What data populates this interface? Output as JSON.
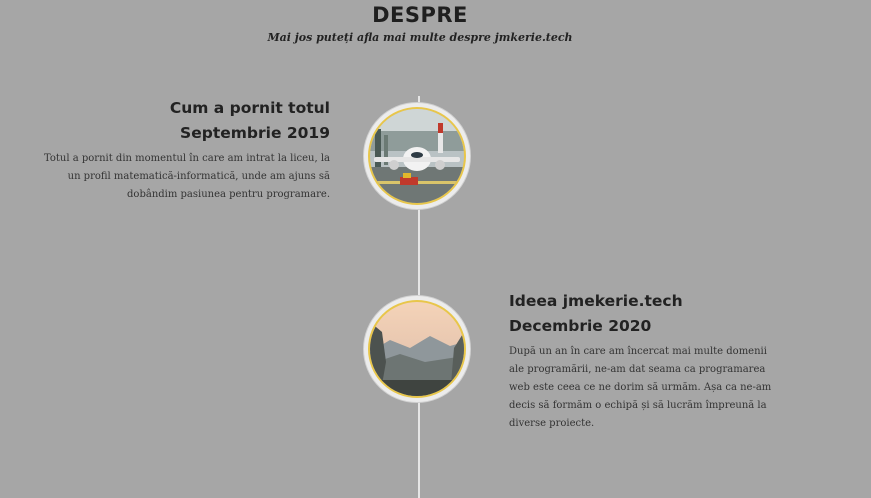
{
  "section": {
    "title": "DESPRE",
    "subtitle": "Mai jos puteți afla mai multe despre jmkerie.tech"
  },
  "timeline": [
    {
      "title": "Cum a pornit totul",
      "date": "Septembrie 2019",
      "description": "Totul a pornit din momentul în care am intrat la liceu, la un profil matematică-informatică, unde am ajuns să dobândim pasiunea pentru programare.",
      "image": "airplane-photo"
    },
    {
      "title": "Ideea jmekerie.tech",
      "date": "Decembrie 2020",
      "description": "După un an în care am încercat mai multe domenii ale programării, ne-am dat seama ca programarea web este ceea ce ne dorim să urmăm. Așa ca ne-am decis să formăm o echipă și să lucrăm împreună la diverse proiecte.",
      "image": "mountain-valley-photo"
    }
  ],
  "colors": {
    "background": "#a6a6a6",
    "timeline_line": "#e6e6e6",
    "image_ring": "#e8c64a",
    "text": "#1f1f1f"
  }
}
